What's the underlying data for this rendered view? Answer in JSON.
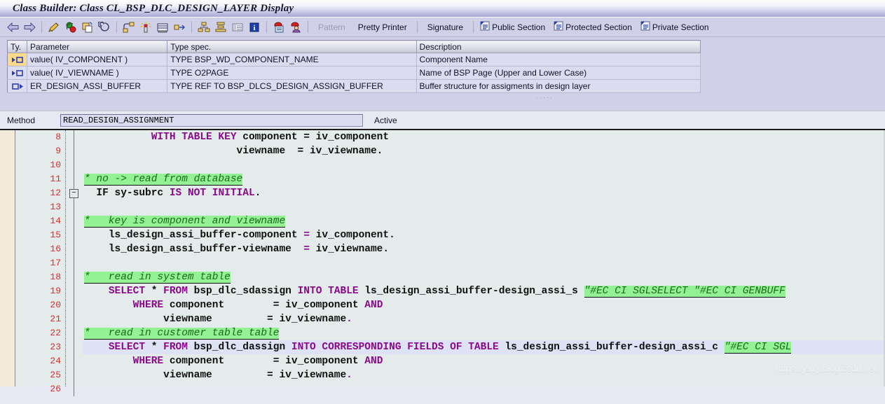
{
  "window": {
    "title": "Class Builder: Class CL_BSP_DLC_DESIGN_LAYER Display"
  },
  "toolbar": {
    "icons": [
      {
        "name": "back-arrow-icon",
        "glyph": "⇦"
      },
      {
        "name": "forward-arrow-icon",
        "glyph": "⇨"
      },
      {
        "name": "check-syntax-icon",
        "glyph": "pencil"
      },
      {
        "name": "activate-icon",
        "glyph": "traffic"
      },
      {
        "name": "copy-object-icon",
        "glyph": "copy"
      },
      {
        "name": "where-used-icon",
        "glyph": "spiral"
      },
      {
        "name": "navigate-icon",
        "glyph": "nav"
      },
      {
        "name": "generate-icon",
        "glyph": "wand"
      },
      {
        "name": "display-object-list-icon",
        "glyph": "list"
      },
      {
        "name": "expand-icon",
        "glyph": "expand"
      },
      {
        "name": "class-hierarchy-icon",
        "glyph": "hier"
      },
      {
        "name": "stack-icon",
        "glyph": "stack"
      },
      {
        "name": "table-icon",
        "glyph": "table"
      },
      {
        "name": "info-icon",
        "glyph": "info"
      },
      {
        "name": "display-change-icon",
        "glyph": "lock1"
      },
      {
        "name": "user-lock-icon",
        "glyph": "lock2"
      }
    ],
    "pattern_label": "Pattern",
    "pretty_printer_label": "Pretty Printer",
    "signature_label": "Signature",
    "public_section_label": "Public Section",
    "protected_section_label": "Protected Section",
    "private_section_label": "Private Section",
    "section_icon_name": "document-section-icon"
  },
  "param_table": {
    "columns": [
      "Ty.",
      "Parameter",
      "Type spec.",
      "Description"
    ],
    "rows": [
      {
        "ty_icon": "importing-parameter-icon",
        "selected": true,
        "parameter": "value( IV_COMPONENT )",
        "type_spec": "TYPE BSP_WD_COMPONENT_NAME",
        "description": "Component Name"
      },
      {
        "ty_icon": "importing-parameter-icon",
        "selected": false,
        "parameter": "value( IV_VIEWNAME )",
        "type_spec": "TYPE O2PAGE",
        "description": "Name of BSP Page (Upper and Lower Case)"
      },
      {
        "ty_icon": "exporting-parameter-icon",
        "selected": false,
        "parameter": "ER_DESIGN_ASSI_BUFFER",
        "type_spec": "TYPE REF TO BSP_DLCS_DESIGN_ASSIGN_BUFFER",
        "description": "Buffer structure for assigments in design layer"
      }
    ]
  },
  "method_bar": {
    "label": "Method",
    "value": "READ_DESIGN_ASSIGNMENT",
    "status": "Active"
  },
  "editor": {
    "first_line_number": 8,
    "fold_marker_line": 12,
    "cursor_line": 23,
    "watermark": "https://jerry.blog.csdn.net",
    "lines": [
      {
        "n": 8,
        "tokens": [
          {
            "t": "plain",
            "v": "           "
          },
          {
            "t": "kw",
            "v": "WITH TABLE KEY"
          },
          {
            "t": "id",
            "v": " component = iv_component"
          }
        ]
      },
      {
        "n": 9,
        "tokens": [
          {
            "t": "plain",
            "v": "                         "
          },
          {
            "t": "id",
            "v": "viewname  = iv_viewname."
          }
        ]
      },
      {
        "n": 10,
        "tokens": []
      },
      {
        "n": 11,
        "tokens": [
          {
            "t": "cm",
            "v": "* no -> read from database"
          }
        ]
      },
      {
        "n": 12,
        "tokens": [
          {
            "t": "plain",
            "v": "  "
          },
          {
            "t": "id",
            "v": "IF sy"
          },
          {
            "t": "op",
            "v": "-"
          },
          {
            "t": "id",
            "v": "subrc "
          },
          {
            "t": "kw",
            "v": "IS NOT INITIAL"
          },
          {
            "t": "id",
            "v": "."
          }
        ]
      },
      {
        "n": 13,
        "tokens": []
      },
      {
        "n": 14,
        "tokens": [
          {
            "t": "cm",
            "v": "*   key is component and viewname"
          }
        ]
      },
      {
        "n": 15,
        "tokens": [
          {
            "t": "plain",
            "v": "    "
          },
          {
            "t": "id",
            "v": "ls_design_assi_buffer-component "
          },
          {
            "t": "kw",
            "v": "="
          },
          {
            "t": "id",
            "v": " iv_component."
          }
        ]
      },
      {
        "n": 16,
        "tokens": [
          {
            "t": "plain",
            "v": "    "
          },
          {
            "t": "id",
            "v": "ls_design_assi_buffer-viewname  "
          },
          {
            "t": "kw",
            "v": "="
          },
          {
            "t": "id",
            "v": " iv_viewname."
          }
        ]
      },
      {
        "n": 17,
        "tokens": []
      },
      {
        "n": 18,
        "tokens": [
          {
            "t": "cm",
            "v": "*   read in system table"
          }
        ]
      },
      {
        "n": 19,
        "tokens": [
          {
            "t": "plain",
            "v": "    "
          },
          {
            "t": "kw",
            "v": "SELECT"
          },
          {
            "t": "id",
            "v": " * "
          },
          {
            "t": "kw",
            "v": "FROM"
          },
          {
            "t": "id",
            "v": " bsp_dlc_sdassign "
          },
          {
            "t": "kw",
            "v": "INTO TABLE"
          },
          {
            "t": "id",
            "v": " ls_design_assi_buffer-design_assi_s "
          },
          {
            "t": "cm",
            "v": "\"#EC CI SGLSELECT \"#EC CI GENBUFF"
          }
        ]
      },
      {
        "n": 20,
        "tokens": [
          {
            "t": "plain",
            "v": "        "
          },
          {
            "t": "kw",
            "v": "WHERE"
          },
          {
            "t": "id",
            "v": " component        = iv_component "
          },
          {
            "t": "kw",
            "v": "AND"
          }
        ]
      },
      {
        "n": 21,
        "tokens": [
          {
            "t": "plain",
            "v": "             "
          },
          {
            "t": "id",
            "v": "viewname         = iv_viewname"
          },
          {
            "t": "kw",
            "v": "."
          }
        ]
      },
      {
        "n": 22,
        "tokens": [
          {
            "t": "cm",
            "v": "*   read in customer table table"
          }
        ]
      },
      {
        "n": 23,
        "tokens": [
          {
            "t": "plain",
            "v": "    "
          },
          {
            "t": "kw",
            "v": "SELECT"
          },
          {
            "t": "id",
            "v": " * "
          },
          {
            "t": "kw",
            "v": "FROM"
          },
          {
            "t": "id",
            "v": " bsp_dlc_dassign "
          },
          {
            "t": "kw",
            "v": "INTO CORRESPONDING FIELDS OF TABLE"
          },
          {
            "t": "id",
            "v": " ls_design_assi_buffer-design_assi_c "
          },
          {
            "t": "cm",
            "v": "\"#EC CI SGL"
          }
        ]
      },
      {
        "n": 24,
        "tokens": [
          {
            "t": "plain",
            "v": "        "
          },
          {
            "t": "kw",
            "v": "WHERE"
          },
          {
            "t": "id",
            "v": " component        = iv_component "
          },
          {
            "t": "kw",
            "v": "AND"
          }
        ]
      },
      {
        "n": 25,
        "tokens": [
          {
            "t": "plain",
            "v": "             "
          },
          {
            "t": "id",
            "v": "viewname         = iv_viewname"
          },
          {
            "t": "kw",
            "v": "."
          }
        ]
      },
      {
        "n": 26,
        "tokens": []
      }
    ]
  }
}
